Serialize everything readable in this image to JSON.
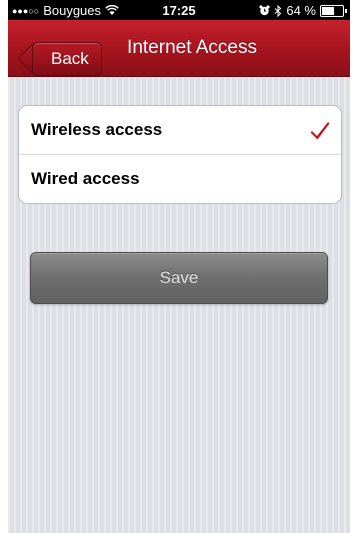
{
  "status_bar": {
    "carrier_signal": "●●●○○",
    "carrier": "Bouygues",
    "wifi_icon": "wifi-icon",
    "time": "17:25",
    "alarm_icon": "alarm-icon",
    "bluetooth_icon": "bluetooth-icon",
    "battery_label": "64 %",
    "battery_level": 0.64
  },
  "nav": {
    "back_label": "Back",
    "title": "Internet Access",
    "bar_color": "#b0171f"
  },
  "options": [
    {
      "label": "Wireless access",
      "selected": true
    },
    {
      "label": "Wired access",
      "selected": false
    }
  ],
  "checkmark_color": "#c0181e",
  "save": {
    "label": "Save"
  }
}
